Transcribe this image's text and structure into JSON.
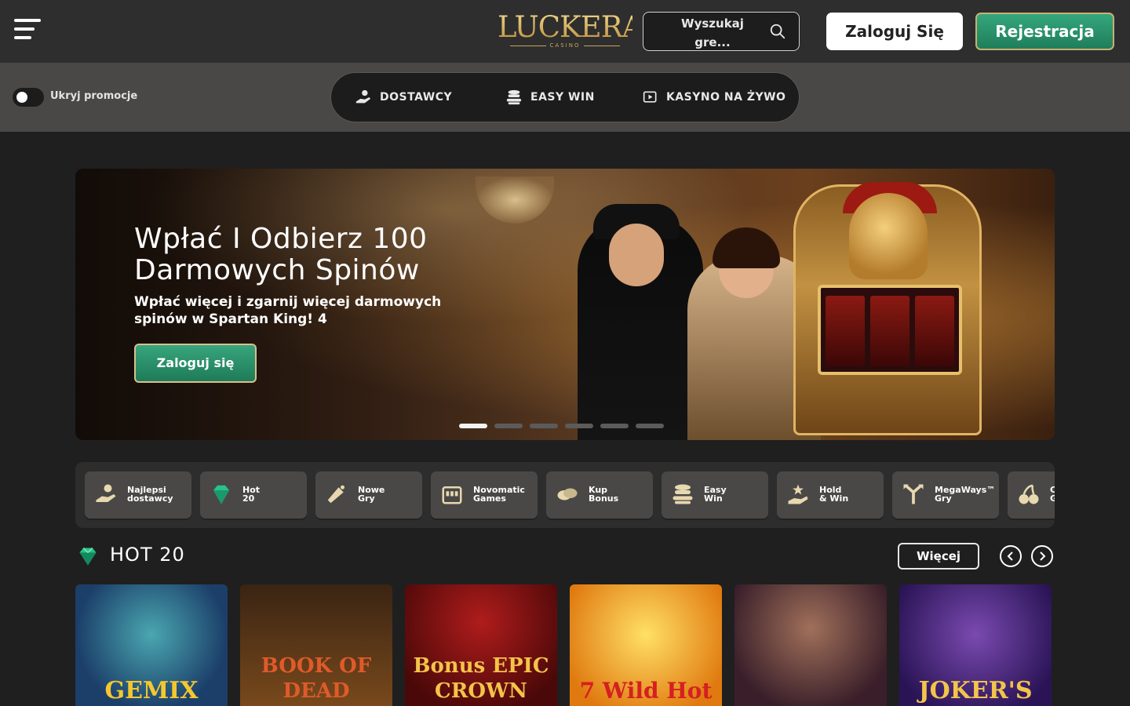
{
  "header": {
    "logo_text": "LUCKERA",
    "logo_sub": "CASINO",
    "search_placeholder": "Wyszukaj gre...",
    "login_label": "Zaloguj Się",
    "register_label": "Rejestracja"
  },
  "subbar": {
    "toggle_label": "Ukryj promocje",
    "nav": [
      {
        "label": "DOSTAWCY",
        "icon": "hand-coin-icon"
      },
      {
        "label": "EASY WIN",
        "icon": "coin-stack-icon"
      },
      {
        "label": "KASYNO NA ŻYWO",
        "icon": "live-play-icon"
      }
    ]
  },
  "banner": {
    "title": "Wpłać I Odbierz 100 Darmowych Spinów",
    "subtitle": "Wpłać więcej i zgarnij więcej darmowych spinów w Spartan King! 4",
    "button_label": "Zaloguj się",
    "slide_count": 6,
    "active_slide": 1
  },
  "categories": [
    {
      "label": "Najlepsi\ndostawcy",
      "icon": "hand-coin-icon"
    },
    {
      "label": "Hot\n20",
      "icon": "diamond-icon"
    },
    {
      "label": "Nowe\nGry",
      "icon": "megaphone-icon"
    },
    {
      "label": "Novomatic\nGames",
      "icon": "slot-machine-icon"
    },
    {
      "label": "Kup\nBonus",
      "icon": "coins-icon"
    },
    {
      "label": "Easy\nWin",
      "icon": "coin-stack-icon"
    },
    {
      "label": "Hold\n& Win",
      "icon": "hand-star-icon"
    },
    {
      "label": "MegaWays™\nGry",
      "icon": "arrows-icon"
    },
    {
      "label": "C\nG",
      "icon": "cherry-icon"
    }
  ],
  "section": {
    "title": "HOT 20",
    "more_label": "Więcej"
  },
  "games": [
    {
      "title": "GEMIX",
      "bg": "#2b5b7a",
      "color": "#f5c72f"
    },
    {
      "title": "BOOK OF DEAD",
      "bg": "#5a3a1c",
      "color": "#e05a2a"
    },
    {
      "title": "Bonus EPIC CROWN",
      "bg": "#7a1414",
      "color": "#f2c44a"
    },
    {
      "title": "7 Wild Hot",
      "bg": "#e0a020",
      "color": "#d42020"
    },
    {
      "title": "",
      "bg": "#4a2c3a",
      "color": "#ffffff"
    },
    {
      "title": "JOKER'S",
      "bg": "#3a1f6a",
      "color": "#f2c44a"
    }
  ],
  "colors": {
    "header_bg": "#2e2e2e",
    "accent_green": "#2a9168",
    "gold": "#d9b563",
    "page_bg": "#1f1f1f"
  }
}
